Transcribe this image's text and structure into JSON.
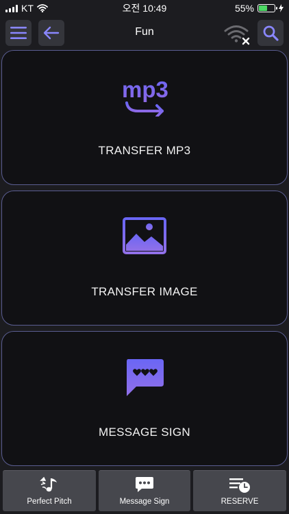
{
  "status_bar": {
    "carrier": "KT",
    "time": "오전 10:49",
    "battery_percent": "55%",
    "battery_level": 0.55
  },
  "toolbar": {
    "title": "Fun",
    "menu_icon": "hamburger-menu-icon",
    "back_icon": "arrow-left-icon",
    "wifi_icon": "wifi-disconnected-icon",
    "search_icon": "search-icon"
  },
  "cards": [
    {
      "label": "TRANSFER MP3",
      "icon": "mp3-transfer-icon",
      "icon_text": "mp3"
    },
    {
      "label": "TRANSFER IMAGE",
      "icon": "image-icon"
    },
    {
      "label": "MESSAGE SIGN",
      "icon": "message-hearts-icon"
    }
  ],
  "tabs": [
    {
      "label": "Perfect Pitch",
      "icon": "music-note-icon"
    },
    {
      "label": "Message Sign",
      "icon": "chat-bubble-icon"
    },
    {
      "label": "RESERVE",
      "icon": "schedule-clock-icon"
    }
  ],
  "colors": {
    "accent": "#7b78ff",
    "card_border": "#5b5e92",
    "background": "#1c1c20",
    "card_fill": "#111114",
    "battery": "#4cd964"
  }
}
